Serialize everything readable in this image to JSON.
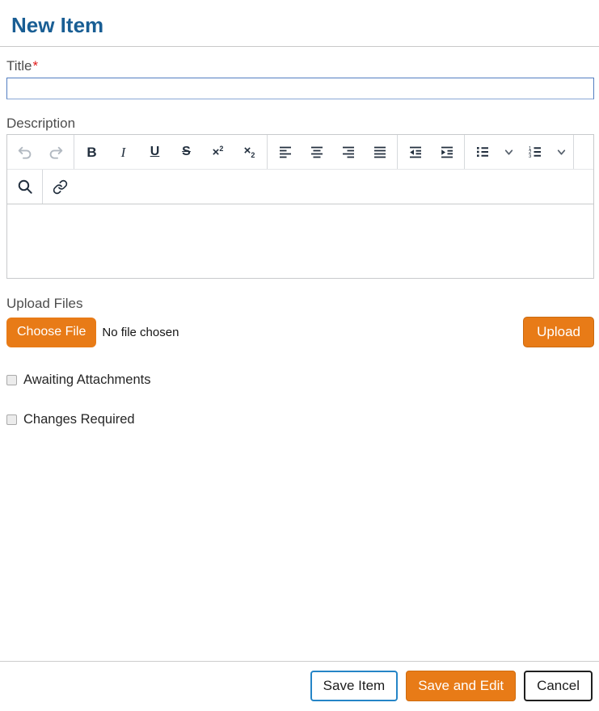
{
  "page": {
    "title": "New Item",
    "background": "#ffffff"
  },
  "colors": {
    "heading_blue": "#195e94",
    "accent_orange": "#e87b17",
    "save_border_blue": "#2585c7",
    "cancel_border": "#1f1f1f",
    "required_red": "#e11b1b",
    "input_border_blue": "#527ec1",
    "toolbar_icon": "#222f3e",
    "toolbar_icon_disabled": "#b2b9c1"
  },
  "form": {
    "title_field": {
      "label": "Title",
      "required_marker": "*",
      "value": ""
    },
    "description_field": {
      "label": "Description",
      "value": ""
    },
    "upload": {
      "label": "Upload Files",
      "choose_file_label": "Choose File",
      "file_status_text": "No file chosen",
      "upload_button_label": "Upload"
    },
    "checkboxes": [
      {
        "label": "Awaiting Attachments",
        "checked": false
      },
      {
        "label": "Changes Required",
        "checked": false
      }
    ]
  },
  "editor": {
    "glyphs": {
      "bold": "B",
      "italic": "I",
      "underline": "U",
      "strikethrough": "S",
      "sup_base": "×",
      "sup_script": "2",
      "sub_base": "×",
      "sub_script": "2",
      "ol_1": "1",
      "ol_2": "2",
      "ol_3": "3"
    },
    "toolbar_row1_icons": [
      "undo-icon",
      "redo-icon",
      "bold",
      "italic",
      "underline",
      "strikethrough",
      "superscript",
      "subscript",
      "align-left-icon",
      "align-center-icon",
      "align-right-icon",
      "align-justify-icon",
      "outdent-icon",
      "indent-icon",
      "bullet-list-icon",
      "chevron-down-icon",
      "numbered-list-icon",
      "chevron-down-icon"
    ],
    "toolbar_row2_icons": [
      "search-icon",
      "link-icon"
    ],
    "content": ""
  },
  "footer": {
    "save_label": "Save Item",
    "save_and_edit_label": "Save and Edit",
    "cancel_label": "Cancel"
  }
}
